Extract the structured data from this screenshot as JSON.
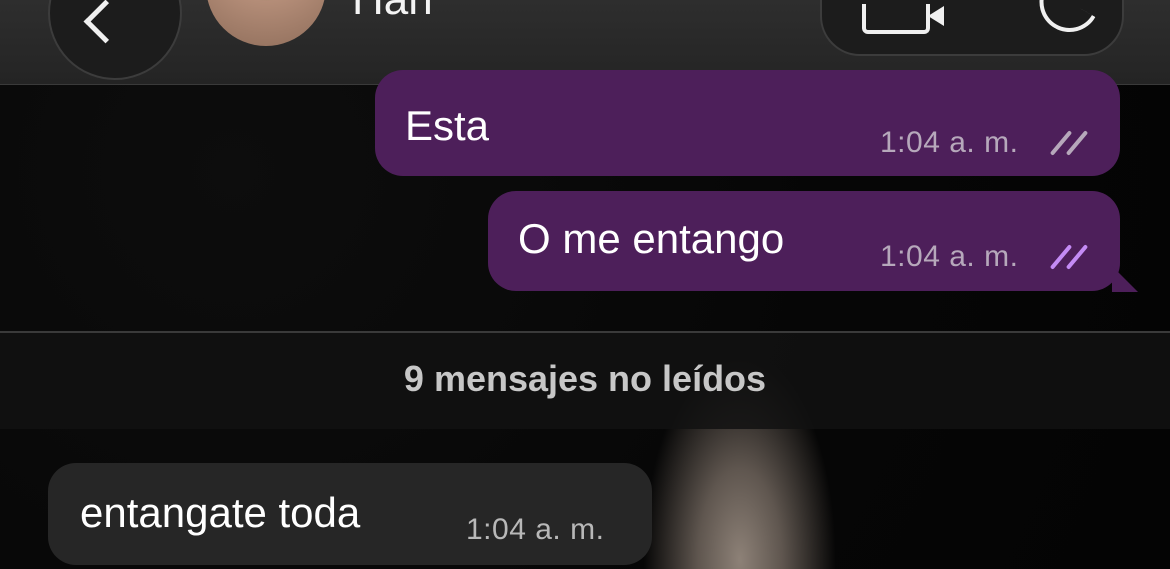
{
  "header": {
    "contact_name": "Han",
    "back_icon": "chevron-left-icon",
    "video_icon": "video-camera-icon",
    "call_icon": "phone-icon"
  },
  "messages": [
    {
      "direction": "outgoing",
      "text": "Esta",
      "time": "1:04 a. m.",
      "status": "delivered"
    },
    {
      "direction": "outgoing",
      "text": "O me entango",
      "time": "1:04 a. m.",
      "status": "read"
    },
    {
      "direction": "incoming",
      "text": "entangate toda",
      "time": "1:04 a. m."
    }
  ],
  "unread_banner": "9 mensajes no leídos",
  "colors": {
    "outgoing_bubble": "#4d1f5a",
    "incoming_bubble": "#262626",
    "read_ticks": "#c48bf5",
    "delivered_ticks": "#b6a8bb"
  }
}
